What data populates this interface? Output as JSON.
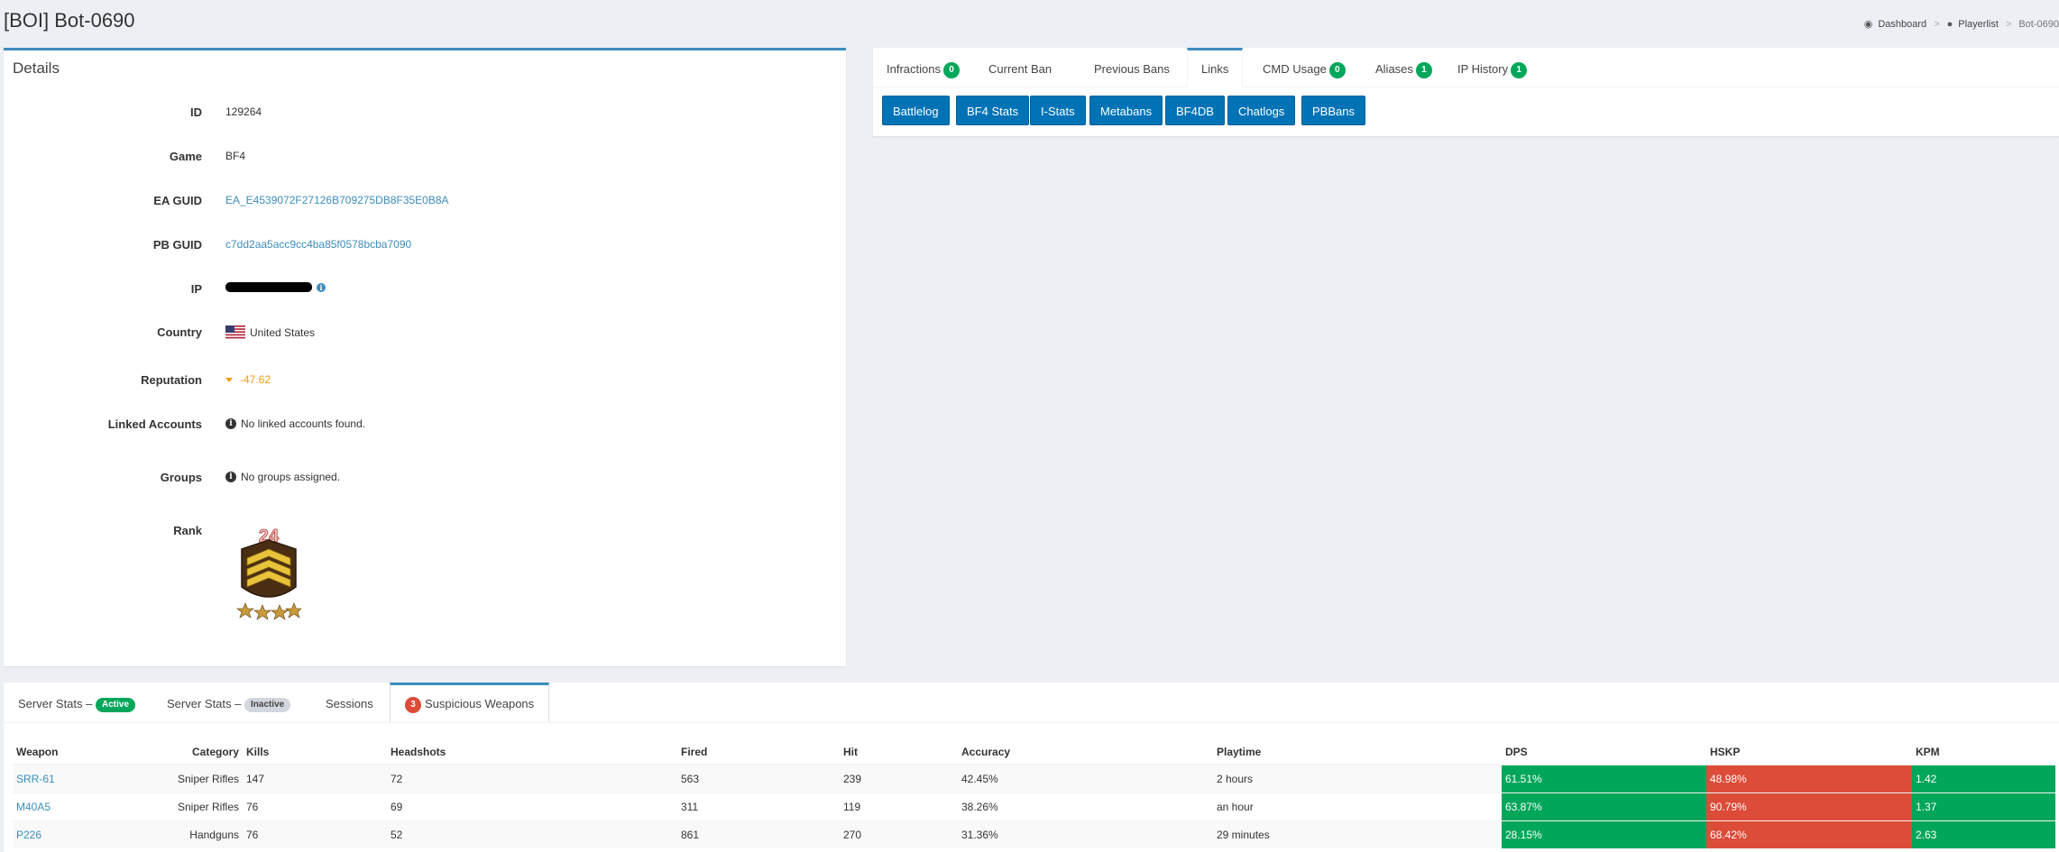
{
  "page": {
    "title": "[BOI] Bot-0690"
  },
  "breadcrumb": {
    "dashboard": "Dashboard",
    "playerlist": "Playerlist",
    "current": "Bot-0690"
  },
  "details": {
    "title": "Details",
    "rows": [
      {
        "label": "ID",
        "value": "129264"
      },
      {
        "label": "Game",
        "value": "BF4"
      },
      {
        "label": "EA GUID",
        "value": "EA_E4539072F27126B709275DB8F35E0B8A"
      },
      {
        "label": "PB GUID",
        "value": "c7dd2aa5acc9cc4ba85f0578bcba7090"
      },
      {
        "label": "IP",
        "value": ""
      },
      {
        "label": "Country",
        "value": "United States"
      },
      {
        "label": "Reputation",
        "value": "-47.62"
      },
      {
        "label": "Linked Accounts",
        "value": "No linked accounts found."
      },
      {
        "label": "Groups",
        "value": "No groups assigned."
      },
      {
        "label": "Rank",
        "value": "24"
      }
    ]
  },
  "tabs": {
    "infractions": {
      "label": "Infractions",
      "badge": "0"
    },
    "current_ban": {
      "label": "Current Ban"
    },
    "previous_bans": {
      "label": "Previous Bans"
    },
    "links": {
      "label": "Links"
    },
    "cmd_usage": {
      "label": "CMD Usage",
      "badge": "0"
    },
    "aliases": {
      "label": "Aliases",
      "badge": "1"
    },
    "ip_history": {
      "label": "IP History",
      "badge": "1"
    }
  },
  "links": [
    "Battlelog",
    "BF4 Stats",
    "I-Stats",
    "Metabans",
    "BF4DB",
    "Chatlogs",
    "PBBans"
  ],
  "bottom_tabs": {
    "active_stats": {
      "label": "Server Stats –",
      "badge": "Active"
    },
    "inactive_stats": {
      "label": "Server Stats –",
      "badge": "Inactive"
    },
    "sessions": {
      "label": "Sessions"
    },
    "suspicious": {
      "label": "Suspicious Weapons",
      "badge": "3"
    }
  },
  "weapons_table": {
    "headers": [
      "Weapon",
      "Category",
      "Kills",
      "Headshots",
      "Fired",
      "Hit",
      "Accuracy",
      "Playtime",
      "DPS",
      "HSKP",
      "KPM"
    ],
    "rows": [
      {
        "weapon": "SRR-61",
        "category": "Sniper Rifles",
        "kills": "147",
        "headshots": "72",
        "fired": "563",
        "hit": "239",
        "accuracy": "42.45%",
        "playtime": "2 hours",
        "dps": "61.51%",
        "hskp": "48.98%",
        "kpm": "1.42"
      },
      {
        "weapon": "M40A5",
        "category": "Sniper Rifles",
        "kills": "76",
        "headshots": "69",
        "fired": "311",
        "hit": "119",
        "accuracy": "38.26%",
        "playtime": "an hour",
        "dps": "63.87%",
        "hskp": "90.79%",
        "kpm": "1.37"
      },
      {
        "weapon": "P226",
        "category": "Handguns",
        "kills": "76",
        "headshots": "52",
        "fired": "861",
        "hit": "270",
        "accuracy": "31.36%",
        "playtime": "29 minutes",
        "dps": "28.15%",
        "hskp": "68.42%",
        "kpm": "2.63"
      }
    ]
  },
  "colors": {
    "accent": "#3c8dbc",
    "success": "#00a65a",
    "danger": "#dd4b39",
    "warning": "#f39c12",
    "button": "#0073b7"
  }
}
